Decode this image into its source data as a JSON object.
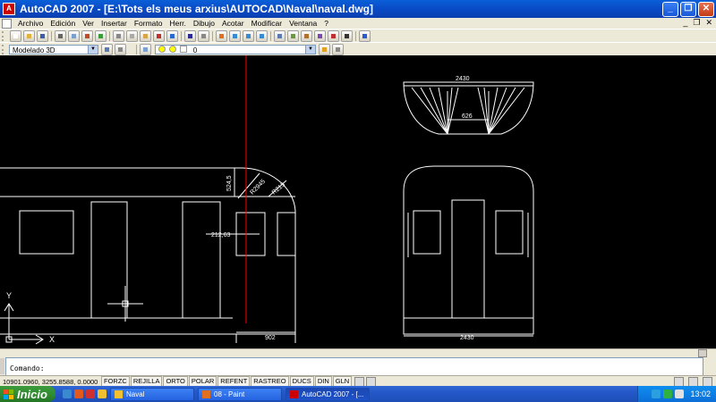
{
  "window": {
    "title": "AutoCAD 2007 - [E:\\Tots els meus arxius\\AUTOCAD\\Naval\\naval.dwg]"
  },
  "menu": [
    "Archivo",
    "Edición",
    "Ver",
    "Insertar",
    "Formato",
    "Herr.",
    "Dibujo",
    "Acotar",
    "Modificar",
    "Ventana",
    "?"
  ],
  "toolbar": {
    "workspace_select": "Modelado 3D",
    "layer_select": "0"
  },
  "drawing": {
    "dims": {
      "top_width": "2430",
      "top_inner": "626",
      "side_height": "524,5",
      "radius_a": "R2945",
      "radius_b": "R215",
      "side_offset": "212,63",
      "bottom_side": "902",
      "front_width": "2430"
    },
    "ucs": {
      "x_label": "X",
      "y_label": "Y"
    }
  },
  "command": {
    "prompt": "Comando:"
  },
  "status": {
    "coords": "10901.0960, 3255.8588, 0.0000",
    "toggles": [
      "FORZC",
      "REJILLA",
      "ORTO",
      "POLAR",
      "REFENT",
      "RASTREO",
      "DUCS",
      "DIN",
      "GLN"
    ]
  },
  "taskbar": {
    "start": "Inicio",
    "buttons": [
      "Naval",
      "08 - Paint",
      "AutoCAD 2007 - [..."
    ],
    "clock": "13:02"
  }
}
